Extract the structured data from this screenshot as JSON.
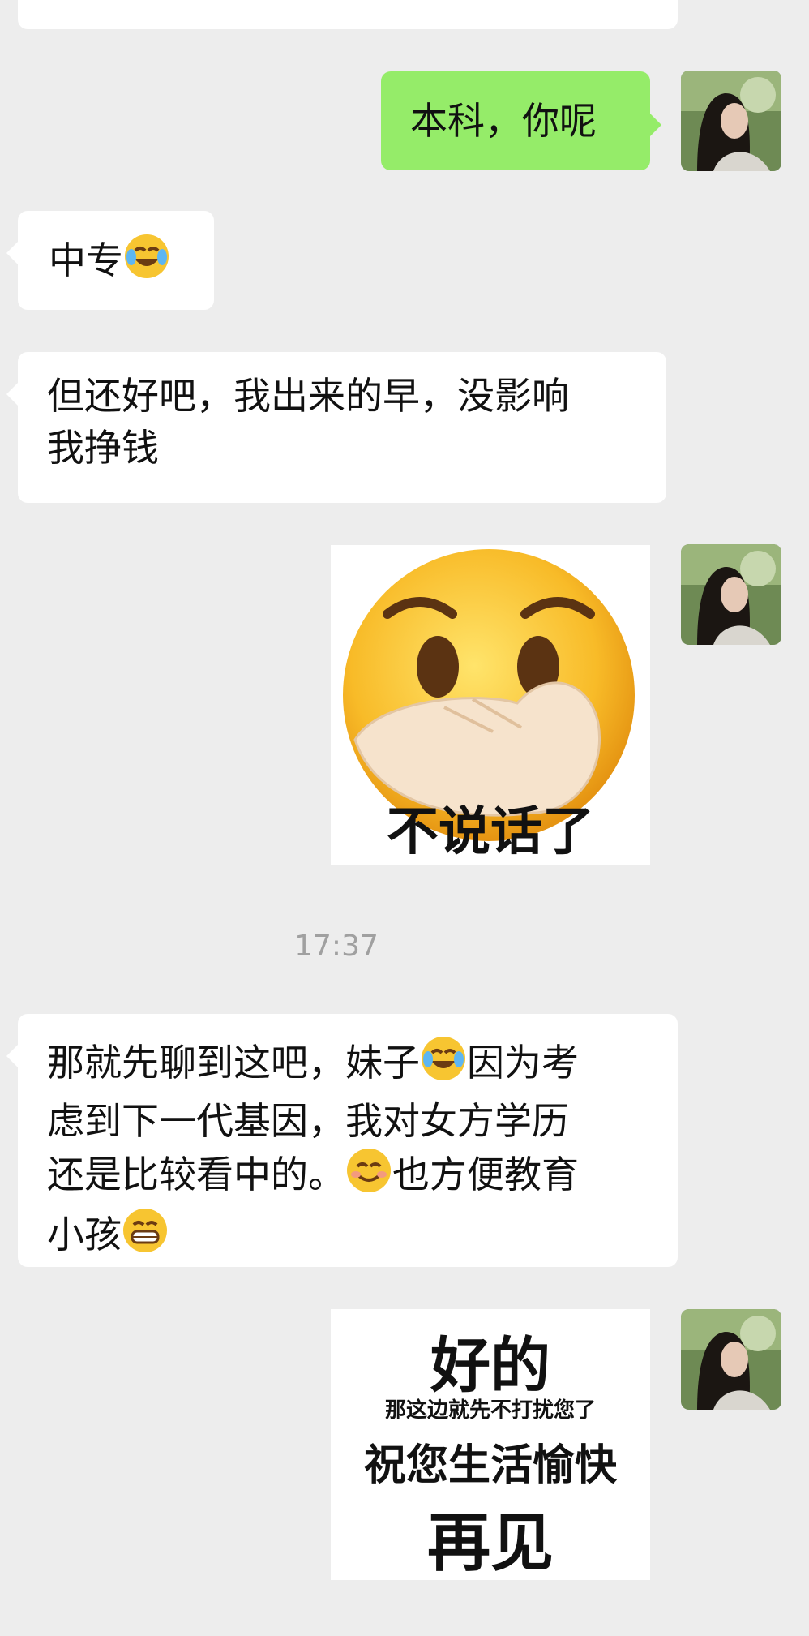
{
  "messages": [
    {
      "id": "m1",
      "side": "right",
      "text": "本科，你呢"
    },
    {
      "id": "m2",
      "side": "left",
      "text": "中专"
    },
    {
      "id": "m3",
      "side": "left",
      "lines": [
        "但还好吧，我出来的早，没影响",
        "我挣钱"
      ]
    },
    {
      "id": "m4",
      "side": "right",
      "sticker_text": "不说话了"
    },
    {
      "id": "m5",
      "side": "left",
      "lines": [
        "那就先聊到这吧，妹子",
        "因为考",
        "虑到下一代基因，我对女方学历",
        "还是比较看中的。",
        "也方便教育",
        "小孩"
      ]
    },
    {
      "id": "m6",
      "side": "right",
      "sticker_lines": [
        "好的",
        "那这边就先不打扰您了",
        "祝您生活愉快",
        "再见"
      ]
    }
  ],
  "timestamp": "17:37",
  "icons": {
    "cry_laugh": "cry-laugh-emoji",
    "smile": "smile-emoji",
    "grin": "grin-emoji",
    "cover_mouth": "cover-mouth-emoji"
  },
  "colors": {
    "background": "#ededed",
    "incoming": "#ffffff",
    "outgoing": "#95ec69"
  }
}
